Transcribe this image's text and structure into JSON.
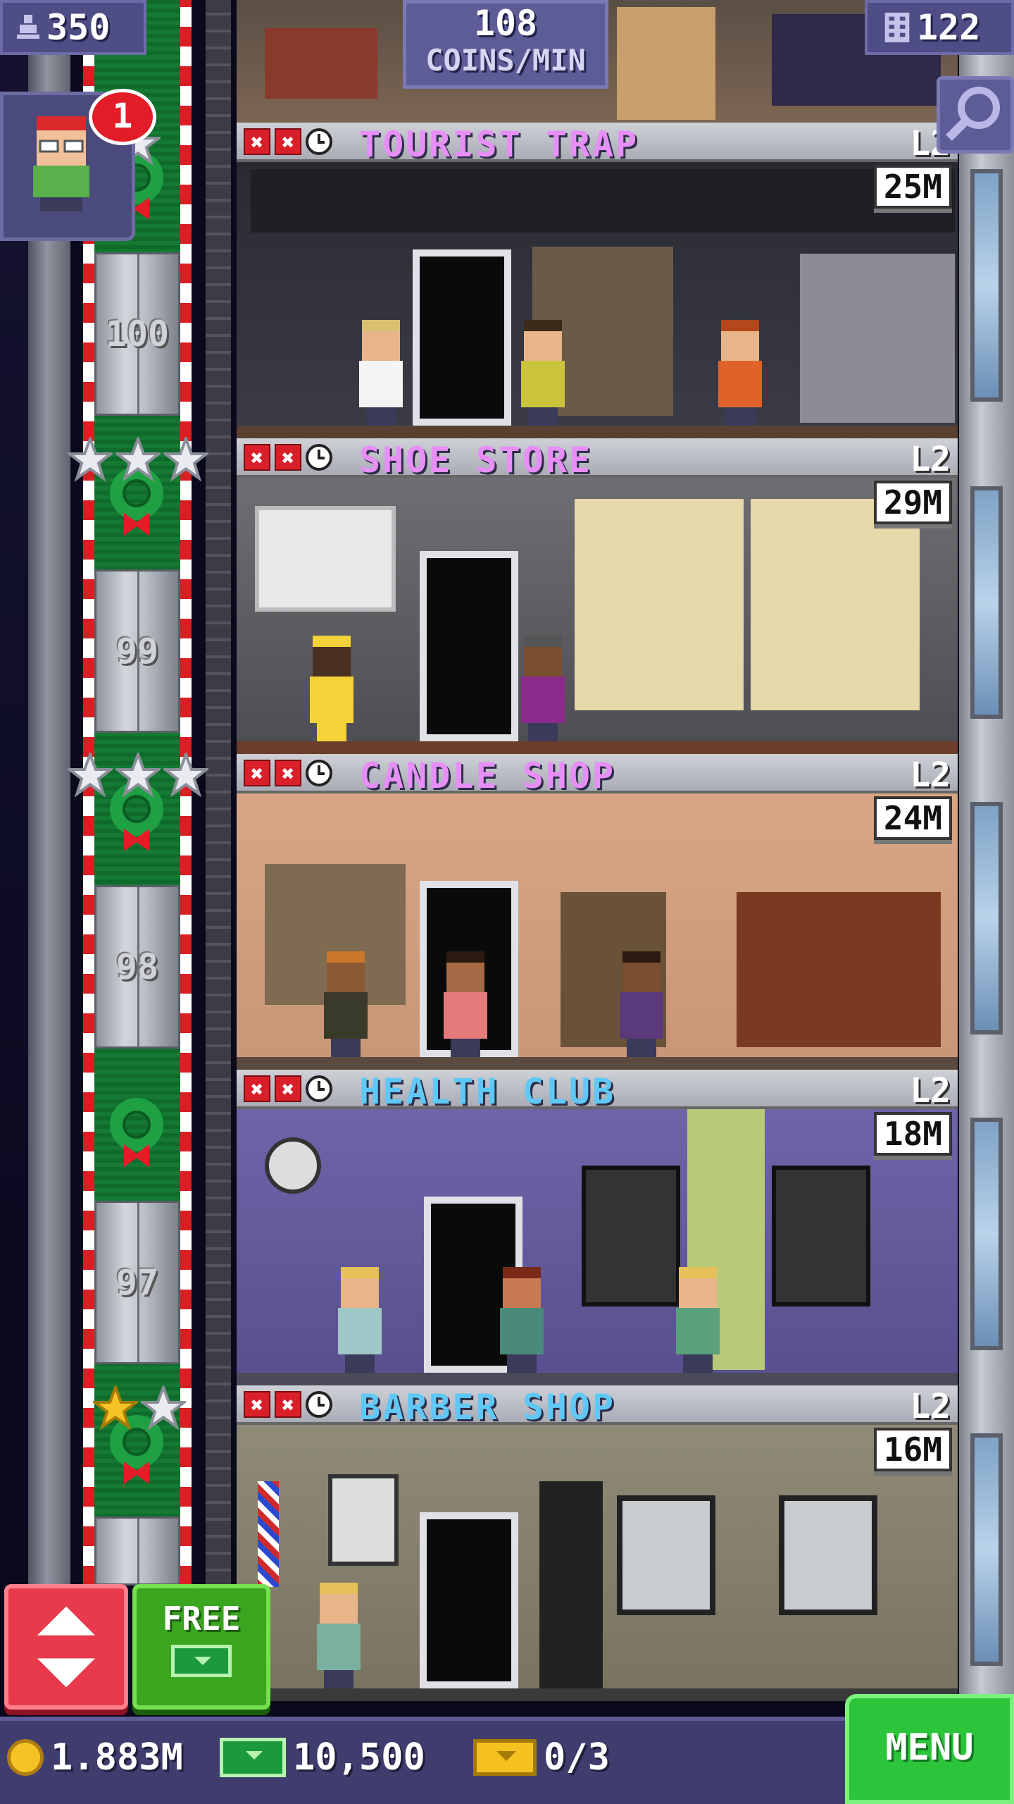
{
  "hud": {
    "population": "350",
    "coin_rate_value": "108",
    "coin_rate_unit": "COINS/MIN",
    "floor_count": "122",
    "visitor_badge_count": "1"
  },
  "elevator": {
    "floor_numbers": [
      "100",
      "99",
      "98",
      "97"
    ]
  },
  "floors": [
    {
      "name": "TOURIST TRAP",
      "level": "L2",
      "income": "25M",
      "name_color": "#e78ef7"
    },
    {
      "name": "SHOE STORE",
      "level": "L2",
      "income": "29M",
      "name_color": "#e78ef7"
    },
    {
      "name": "CANDLE SHOP",
      "level": "L2",
      "income": "24M",
      "name_color": "#e78ef7"
    },
    {
      "name": "HEALTH CLUB",
      "level": "L2",
      "income": "18M",
      "name_color": "#5fc8f7"
    },
    {
      "name": "BARBER SHOP",
      "level": "L2",
      "income": "16M",
      "name_color": "#5fc8f7"
    }
  ],
  "buttons": {
    "free_label": "FREE",
    "menu_label": "MENU"
  },
  "bottom_bar": {
    "coins": "1.883M",
    "tower_bux": "10,500",
    "tickets": "0/3"
  },
  "icons": {
    "population": "person-icon",
    "floors": "building-icon",
    "search": "magnifier-icon",
    "elevator": "up-down-arrows-icon",
    "coins": "coin-icon",
    "bux": "tower-bux-icon",
    "tickets": "golden-ticket-icon"
  }
}
